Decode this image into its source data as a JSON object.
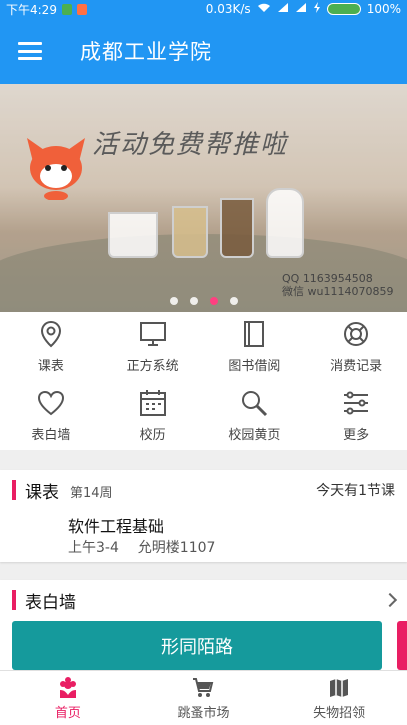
{
  "status_bar": {
    "time": "下午4:29",
    "speed": "0.03K/s",
    "battery": "100%"
  },
  "app_bar": {
    "title": "成都工业学院"
  },
  "banner": {
    "text": "活动免费帮推啦",
    "qq_line": "QQ 1163954508",
    "wechat_line": "微信 wu1114070859",
    "slide_count": 4,
    "active_slide": 3
  },
  "grid": {
    "items": [
      {
        "label": "课表",
        "icon": "location-pin-icon"
      },
      {
        "label": "正方系统",
        "icon": "monitor-icon"
      },
      {
        "label": "图书借阅",
        "icon": "book-icon"
      },
      {
        "label": "消费记录",
        "icon": "lifebuoy-icon"
      },
      {
        "label": "表白墙",
        "icon": "heart-icon"
      },
      {
        "label": "校历",
        "icon": "calendar-icon"
      },
      {
        "label": "校园黄页",
        "icon": "magnifier-icon"
      },
      {
        "label": "更多",
        "icon": "sliders-icon"
      }
    ]
  },
  "schedule": {
    "title": "课表",
    "week": "第14周",
    "today": "今天有1节课",
    "course_name": "软件工程基础",
    "course_time": "上午3-4",
    "course_room": "允明楼1107"
  },
  "wall": {
    "title": "表白墙",
    "card_text": "形同陌路"
  },
  "bottom_nav": {
    "items": [
      {
        "label": "首页",
        "icon": "flower-home-icon",
        "active": true
      },
      {
        "label": "跳蚤市场",
        "icon": "cart-icon",
        "active": false
      },
      {
        "label": "失物招领",
        "icon": "map-icon",
        "active": false
      }
    ]
  },
  "colors": {
    "primary": "#2196f3",
    "accent": "#e91e63",
    "teal": "#159a9c"
  }
}
